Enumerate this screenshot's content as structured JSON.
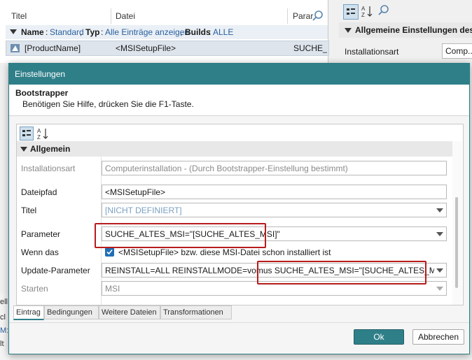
{
  "background": {
    "grid": {
      "columns": [
        "Titel",
        "Datei",
        "Parar"
      ],
      "filter": {
        "name_label": "Name",
        "name_value": "Standard",
        "type_label": "Typ",
        "type_value": "Alle Einträge anzeigen",
        "builds_label": "Builds",
        "builds_value": "ALLE"
      },
      "row": {
        "title": "[ProductName]",
        "file": "<MSISetupFile>",
        "param": "SUCHE_A"
      }
    },
    "right_panel": {
      "section": "Allgemeine Einstellungen des I",
      "prop_label": "Installationsart",
      "prop_value": "Comp..."
    },
    "left_tail": [
      "ell",
      "cl",
      "M:\\",
      "lt"
    ]
  },
  "dialog": {
    "title": "Einstellungen",
    "info_heading": "Bootstrapper",
    "info_text": "Benötigen Sie Hilfe, drücken Sie die F1-Taste.",
    "category": "Allgemein",
    "properties": [
      {
        "label": "Installationsart",
        "value": "Computerinstallation - (Durch Bootstrapper-Einstellung bestimmt)"
      },
      {
        "label": "Dateipfad",
        "value": "<MSISetupFile>"
      },
      {
        "label": "Titel",
        "value": "[NICHT DEFINIERT]"
      },
      {
        "label": "Parameter",
        "value": "SUCHE_ALTES_MSI=\"[SUCHE_ALTES_MSI]\""
      },
      {
        "label": "Wenn das",
        "value": "<MSISetupFile> bzw. diese MSI-Datei schon installiert ist"
      },
      {
        "label": "Update-Parameter",
        "value": "REINSTALL=ALL REINSTALLMODE=vomus SUCHE_ALTES_MSI=\"[SUCHE_ALTES_MSI]\""
      },
      {
        "label": "Starten",
        "value": "MSI"
      }
    ],
    "tabs": [
      "Eintrag",
      "Bedingungen",
      "Weitere Dateien",
      "Transformationen"
    ],
    "ok_label": "Ok",
    "cancel_label": "Abbrechen"
  },
  "colors": {
    "accent": "#2f7f89",
    "highlight": "#b71c1c"
  }
}
